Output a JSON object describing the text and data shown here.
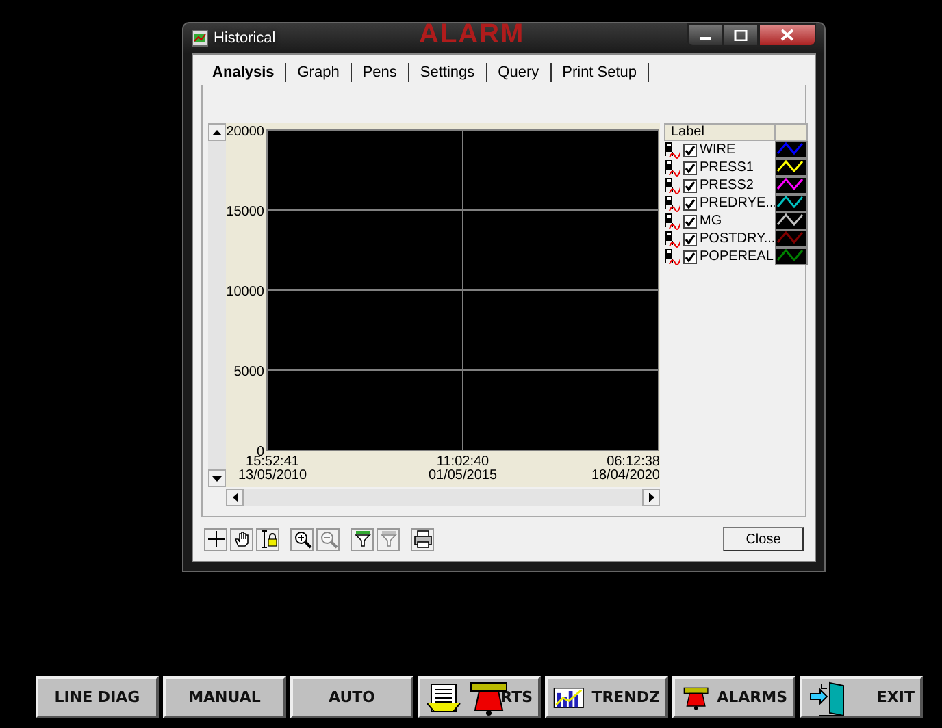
{
  "background_text": "ALARM",
  "window": {
    "title": "Historical"
  },
  "tabs": [
    {
      "label": "Analysis",
      "selected": true
    },
    {
      "label": "Graph",
      "selected": false
    },
    {
      "label": "Pens",
      "selected": false
    },
    {
      "label": "Settings",
      "selected": false
    },
    {
      "label": "Query",
      "selected": false
    },
    {
      "label": "Print Setup",
      "selected": false
    }
  ],
  "chart": {
    "chart_data": {
      "type": "line",
      "grid": true,
      "ylim": [
        0,
        20000
      ],
      "yticks": [
        0,
        5000,
        10000,
        15000,
        20000
      ],
      "categories": [
        "15:52:41\n13/05/2010",
        "11:02:40\n01/05/2015",
        "06:12:38\n18/04/2020"
      ]
    }
  },
  "legend": {
    "columns": [
      "Label"
    ],
    "pens": [
      {
        "label": "WIRE",
        "checked": true,
        "color": "#0000ff"
      },
      {
        "label": "PRESS1",
        "checked": true,
        "color": "#ffff00"
      },
      {
        "label": "PRESS2",
        "checked": true,
        "color": "#ff00ff"
      },
      {
        "label": "PREDRYE...",
        "checked": true,
        "color": "#00c0c0"
      },
      {
        "label": "MG",
        "checked": true,
        "color": "#c0c0c0"
      },
      {
        "label": "POSTDRY...",
        "checked": true,
        "color": "#800000"
      },
      {
        "label": "POPEREAL",
        "checked": true,
        "color": "#008000"
      }
    ]
  },
  "toolbar": [
    {
      "kind": "crosshair",
      "disabled": false
    },
    {
      "kind": "hand",
      "disabled": false
    },
    {
      "kind": "lock",
      "disabled": false
    },
    {
      "kind": "zoomin",
      "disabled": false
    },
    {
      "kind": "zoomout",
      "disabled": true
    },
    {
      "kind": "filter",
      "disabled": false
    },
    {
      "kind": "filter",
      "disabled": true
    },
    {
      "kind": "printer",
      "disabled": false
    }
  ],
  "close_button": "Close",
  "nav_buttons": [
    {
      "kind": "text",
      "label": "LINE DIAG"
    },
    {
      "kind": "text",
      "label": "MANUAL"
    },
    {
      "kind": "text",
      "label": "AUTO"
    },
    {
      "kind": "reports",
      "label": "RTS"
    },
    {
      "kind": "trend",
      "label": "TRENDZ"
    },
    {
      "kind": "bell",
      "label": "ALARMS"
    },
    {
      "kind": "door",
      "label": "EXIT"
    }
  ]
}
